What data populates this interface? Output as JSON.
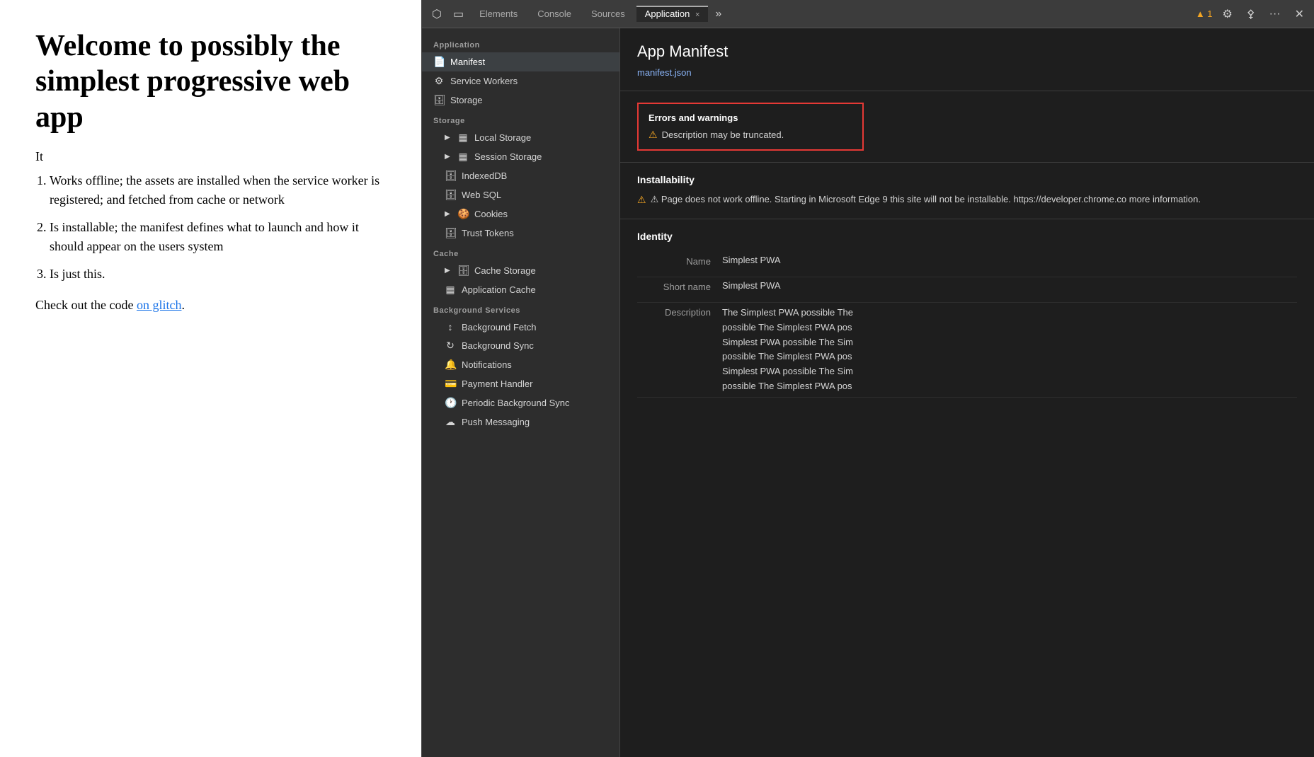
{
  "webpage": {
    "heading": "Welcome to possibly the simplest progressive web app",
    "intro": "It",
    "list": [
      "Works offline; the assets are installed when the service worker is registered; and fetched from cache or network",
      "Is installable; the manifest defines what to launch and how it should appear on the users system",
      "Is just this."
    ],
    "check_text": "Check out the code ",
    "check_link_text": "on glitch",
    "check_suffix": "."
  },
  "devtools": {
    "tabs": [
      {
        "label": "Elements",
        "active": false
      },
      {
        "label": "Console",
        "active": false
      },
      {
        "label": "Sources",
        "active": false
      },
      {
        "label": "Application",
        "active": true
      }
    ],
    "warn_badge": "▲ 1",
    "tab_close": "×",
    "more_tabs": "»",
    "icons": {
      "cursor": "⬡",
      "device": "▭",
      "settings": "⚙",
      "person": "👤",
      "ellipsis": "···",
      "close": "✕"
    }
  },
  "sidebar": {
    "sections": [
      {
        "header": "Application",
        "items": [
          {
            "label": "Manifest",
            "icon": "📄",
            "level": 1,
            "active": true
          },
          {
            "label": "Service Workers",
            "icon": "⚙",
            "level": 1,
            "active": false
          },
          {
            "label": "Storage",
            "icon": "🗄",
            "level": 1,
            "active": false
          }
        ]
      },
      {
        "header": "Storage",
        "items": [
          {
            "label": "Local Storage",
            "icon": "▶",
            "db_icon": "▦",
            "level": 2,
            "expandable": true
          },
          {
            "label": "Session Storage",
            "icon": "▶",
            "db_icon": "▦",
            "level": 2,
            "expandable": true
          },
          {
            "label": "IndexedDB",
            "icon": "🗄",
            "level": 2
          },
          {
            "label": "Web SQL",
            "icon": "🗄",
            "level": 2
          },
          {
            "label": "Cookies",
            "icon": "▶",
            "db_icon": "🍪",
            "level": 2,
            "expandable": true
          },
          {
            "label": "Trust Tokens",
            "icon": "🗄",
            "level": 2
          }
        ]
      },
      {
        "header": "Cache",
        "items": [
          {
            "label": "Cache Storage",
            "icon": "▶",
            "db_icon": "🗄",
            "level": 2,
            "expandable": true
          },
          {
            "label": "Application Cache",
            "icon": "▦",
            "level": 2
          }
        ]
      },
      {
        "header": "Background Services",
        "items": [
          {
            "label": "Background Fetch",
            "icon": "↕",
            "level": 2
          },
          {
            "label": "Background Sync",
            "icon": "↻",
            "level": 2
          },
          {
            "label": "Notifications",
            "icon": "🔔",
            "level": 2
          },
          {
            "label": "Payment Handler",
            "icon": "💳",
            "level": 2
          },
          {
            "label": "Periodic Background Sync",
            "icon": "🕐",
            "level": 2
          },
          {
            "label": "Push Messaging",
            "icon": "☁",
            "level": 2
          }
        ]
      }
    ]
  },
  "main": {
    "title": "App Manifest",
    "manifest_link": "manifest.json",
    "errors_section": {
      "heading": "Errors and warnings",
      "warning": "⚠ Description may be truncated."
    },
    "installability": {
      "heading": "Installability",
      "text": "⚠ Page does not work offline. Starting in Microsoft Edge 9 this site will not be installable. https://developer.chrome.co more information."
    },
    "identity": {
      "heading": "Identity",
      "rows": [
        {
          "label": "Name",
          "value": "Simplest PWA"
        },
        {
          "label": "Short name",
          "value": "Simplest PWA"
        },
        {
          "label": "Description",
          "lines": [
            "The Simplest PWA possible The",
            "possible The Simplest PWA pos",
            "Simplest PWA possible The Sim",
            "possible The Simplest PWA pos",
            "Simplest PWA possible The Sim",
            "possible The Simplest PWA pos"
          ]
        }
      ]
    }
  }
}
